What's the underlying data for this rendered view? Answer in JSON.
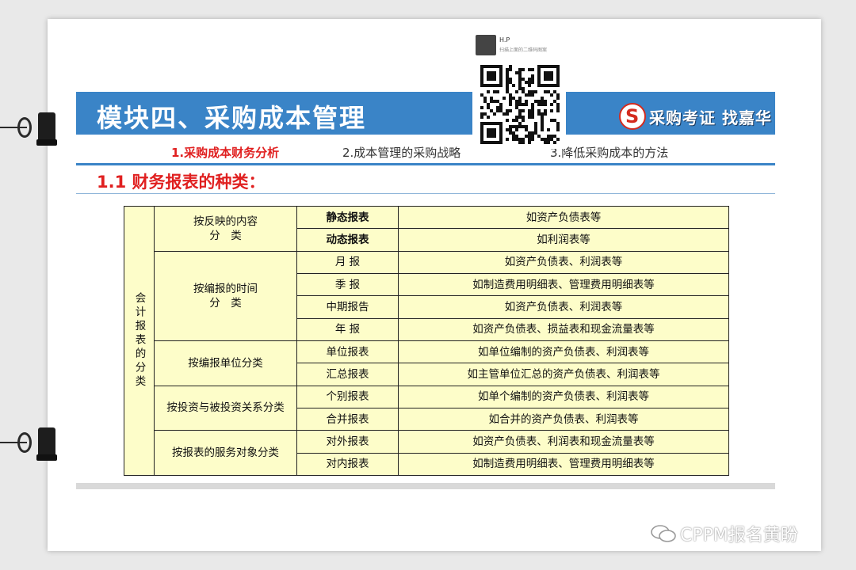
{
  "slide": {
    "title": "模块四、采购成本管理",
    "brand_text": "采购考证 找嘉华",
    "brand_logo_letter": "S",
    "colors": {
      "banner": "#3a84c7",
      "accent": "#e02020",
      "table_bg": "#fdfdc9",
      "highlight_text": "#1b2fb5"
    }
  },
  "tabs": [
    {
      "label": "1.采购成本财务分析",
      "active": true
    },
    {
      "label": "2.成本管理的采购战略",
      "active": false
    },
    {
      "label": "3.降低采购成本的方法",
      "active": false
    }
  ],
  "section": {
    "title": "1.1 财务报表的种类："
  },
  "table": {
    "root_label": "会计报表的分类",
    "groups": [
      {
        "category": "按反映的内容\n分　类",
        "rows": [
          {
            "type": "静态报表",
            "example": "如资产负债表等",
            "highlight": true
          },
          {
            "type": "动态报表",
            "example": "如利润表等",
            "highlight": true
          }
        ]
      },
      {
        "category": "按编报的时间\n分　类",
        "rows": [
          {
            "type": "月 报",
            "example": "如资产负债表、利润表等"
          },
          {
            "type": "季 报",
            "example": "如制造费用明细表、管理费用明细表等"
          },
          {
            "type": "中期报告",
            "example": "如资产负债表、利润表等"
          },
          {
            "type": "年 报",
            "example": "如资产负债表、损益表和现金流量表等"
          }
        ]
      },
      {
        "category": "按编报单位分类",
        "rows": [
          {
            "type": "单位报表",
            "example": "如单位编制的资产负债表、利润表等"
          },
          {
            "type": "汇总报表",
            "example": "如主管单位汇总的资产负债表、利润表等"
          }
        ]
      },
      {
        "category": "按投资与被投资关系分类",
        "rows": [
          {
            "type": "个别报表",
            "example": "如单个编制的资产负债表、利润表等"
          },
          {
            "type": "合并报表",
            "example": "如合并的资产负债表、利润表等"
          }
        ]
      },
      {
        "category": "按报表的服务对象分类",
        "rows": [
          {
            "type": "对外报表",
            "example": "如资产负债表、利润表和现金流量表等"
          },
          {
            "type": "对内报表",
            "example": "如制造费用明细表、管理费用明细表等"
          }
        ]
      }
    ]
  },
  "qr_card": {
    "name": "H.P",
    "subtitle": "扫描上面的二维码图案"
  },
  "watermark": {
    "text": "CPPM报名黄盼"
  }
}
